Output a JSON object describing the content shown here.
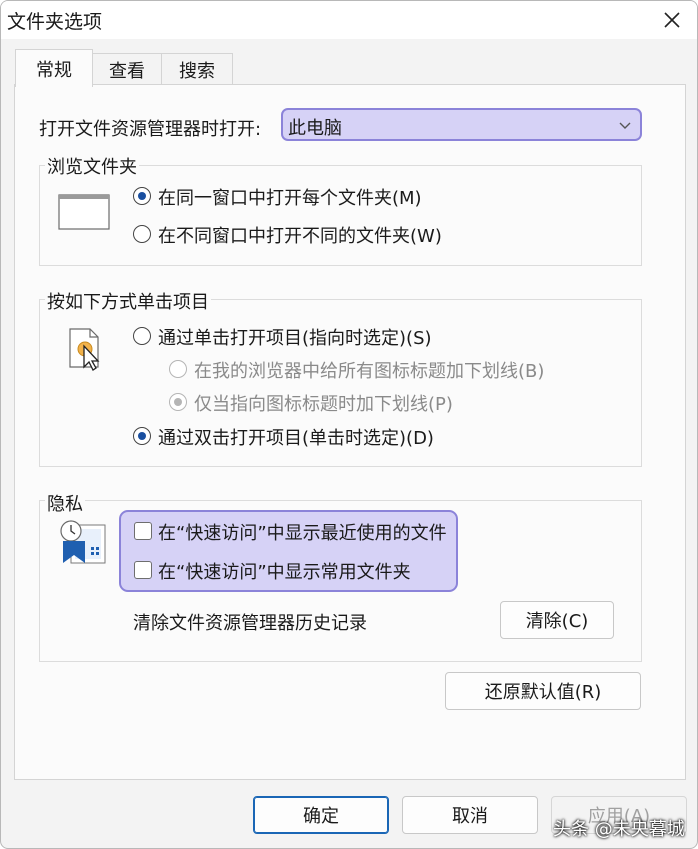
{
  "window": {
    "title": "文件夹选项"
  },
  "tabs": [
    {
      "label": "常规",
      "active": true
    },
    {
      "label": "查看",
      "active": false
    },
    {
      "label": "搜索",
      "active": false
    }
  ],
  "open_in": {
    "label": "打开文件资源管理器时打开:",
    "value": "此电脑"
  },
  "browse": {
    "title": "浏览文件夹",
    "options": [
      {
        "label": "在同一窗口中打开每个文件夹(M)",
        "selected": true
      },
      {
        "label": "在不同窗口中打开不同的文件夹(W)",
        "selected": false
      }
    ]
  },
  "click": {
    "title": "按如下方式单击项目",
    "single": {
      "label": "通过单击打开项目(指向时选定)(S)",
      "selected": false
    },
    "sub_options": [
      {
        "label": "在我的浏览器中给所有图标标题加下划线(B)",
        "selected": false,
        "enabled": false
      },
      {
        "label": "仅当指向图标标题时加下划线(P)",
        "selected": true,
        "enabled": false
      }
    ],
    "double": {
      "label": "通过双击打开项目(单击时选定)(D)",
      "selected": true
    }
  },
  "privacy": {
    "title": "隐私",
    "checks": [
      {
        "label": "在“快速访问”中显示最近使用的文件",
        "checked": false
      },
      {
        "label": "在“快速访问”中显示常用文件夹",
        "checked": false
      }
    ],
    "clear_label": "清除文件资源管理器历史记录",
    "clear_button": "清除(C)"
  },
  "restore_button": "还原默认值(R)",
  "footer": {
    "ok": "确定",
    "cancel": "取消",
    "apply": "应用(A)"
  },
  "watermark": "头条 @未央暮城",
  "colors": {
    "highlight_fill": "#d6d2f6",
    "highlight_border": "#8b83d9",
    "accent": "#1a4fa0"
  }
}
